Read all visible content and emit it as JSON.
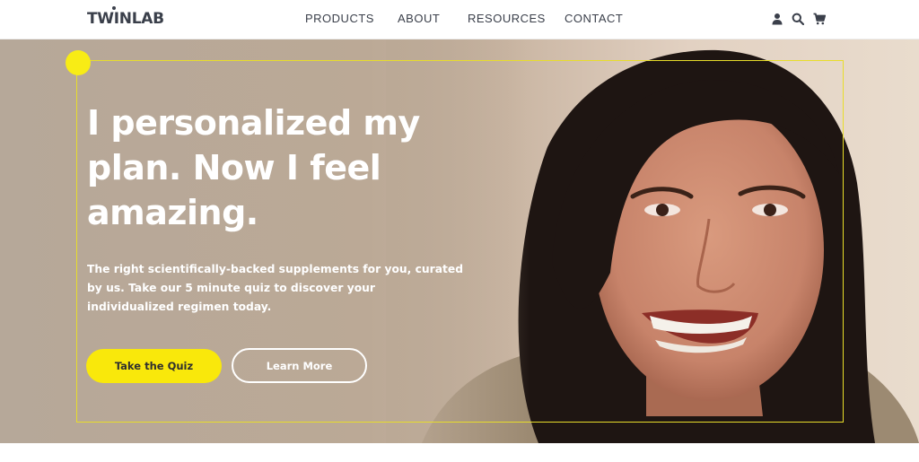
{
  "header": {
    "logo": "TWINLAB",
    "nav": [
      "PRODUCTS",
      "ABOUT",
      "RESOURCES",
      "CONTACT"
    ],
    "icons": [
      "user-icon",
      "search-icon",
      "cart-icon"
    ]
  },
  "hero": {
    "headline": "I personalized my plan. Now I feel amazing.",
    "subcopy": "The right scientifically-backed supplements for you, curated by us. Take our 5 minute quiz to discover your individualized regimen today.",
    "primary_button": "Take the Quiz",
    "secondary_button": "Learn More"
  },
  "colors": {
    "accent_yellow": "#f9e80b",
    "hero_bg": "#bba996",
    "nav_text": "#3a3f4a"
  }
}
